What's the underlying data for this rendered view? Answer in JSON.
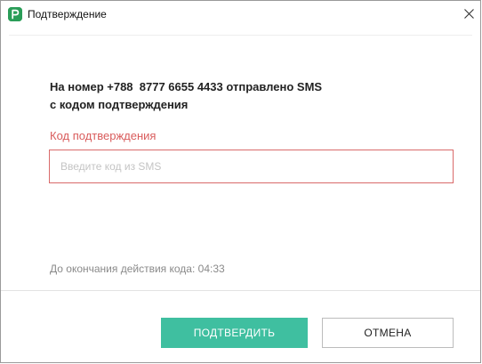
{
  "window": {
    "title": "Подтверждение",
    "close_icon": "close-icon"
  },
  "message": {
    "text": "На номер +788  8777 6655 4433 отправлено SMS\nс кодом подтверждения"
  },
  "code_field": {
    "label": "Код подтверждения",
    "placeholder": "Введите код из SMS",
    "value": ""
  },
  "expiry": {
    "text": "До окончания действия кода: 04:33"
  },
  "buttons": {
    "confirm_label": "ПОДТВЕРДИТЬ",
    "cancel_label": "ОТМЕНА"
  },
  "colors": {
    "accent": "#3fbfa0",
    "error": "#d95c5c",
    "app_icon": "#2a9d58"
  }
}
